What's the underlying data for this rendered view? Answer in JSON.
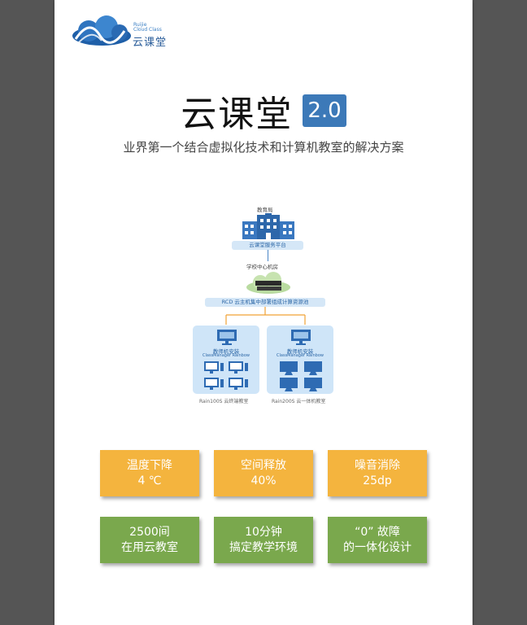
{
  "logo": {
    "en_line1": "Ruijie",
    "en_line2": "Cloud Class",
    "cn": "云课堂"
  },
  "title": "云课堂",
  "version": "2.0",
  "subtitle": "业界第一个结合虚拟化技术和计算机教室的解决方案",
  "diagram": {
    "edu_bureau": "教育局",
    "platform": "云课堂服务平台",
    "school_room": "学校中心机房",
    "rcd": "RCD 云主机集中部署组成计算资源池",
    "left_panel": {
      "title": "教师机安装",
      "sub": "ClassManager Rainbow",
      "caption": "Rain100S 云终端教室"
    },
    "right_panel": {
      "title": "教师机安装",
      "sub": "ClassManager Rainbow",
      "caption": "Rain200S 云一体机教室"
    }
  },
  "cards": [
    {
      "line1": "温度下降",
      "line2": "4 ℃",
      "color": "#f4b43e"
    },
    {
      "line1": "空间释放",
      "line2": "40%",
      "color": "#f4b43e"
    },
    {
      "line1": "噪音消除",
      "line2": "25dp",
      "color": "#f4b43e"
    },
    {
      "line1": "2500间",
      "line2": "在用云教室",
      "color": "#7aa84d"
    },
    {
      "line1": "10分钟",
      "line2": "搞定教学环境",
      "color": "#7aa84d"
    },
    {
      "line1": "“0” 故障",
      "line2": "的一体化设计",
      "color": "#7aa84d"
    }
  ]
}
